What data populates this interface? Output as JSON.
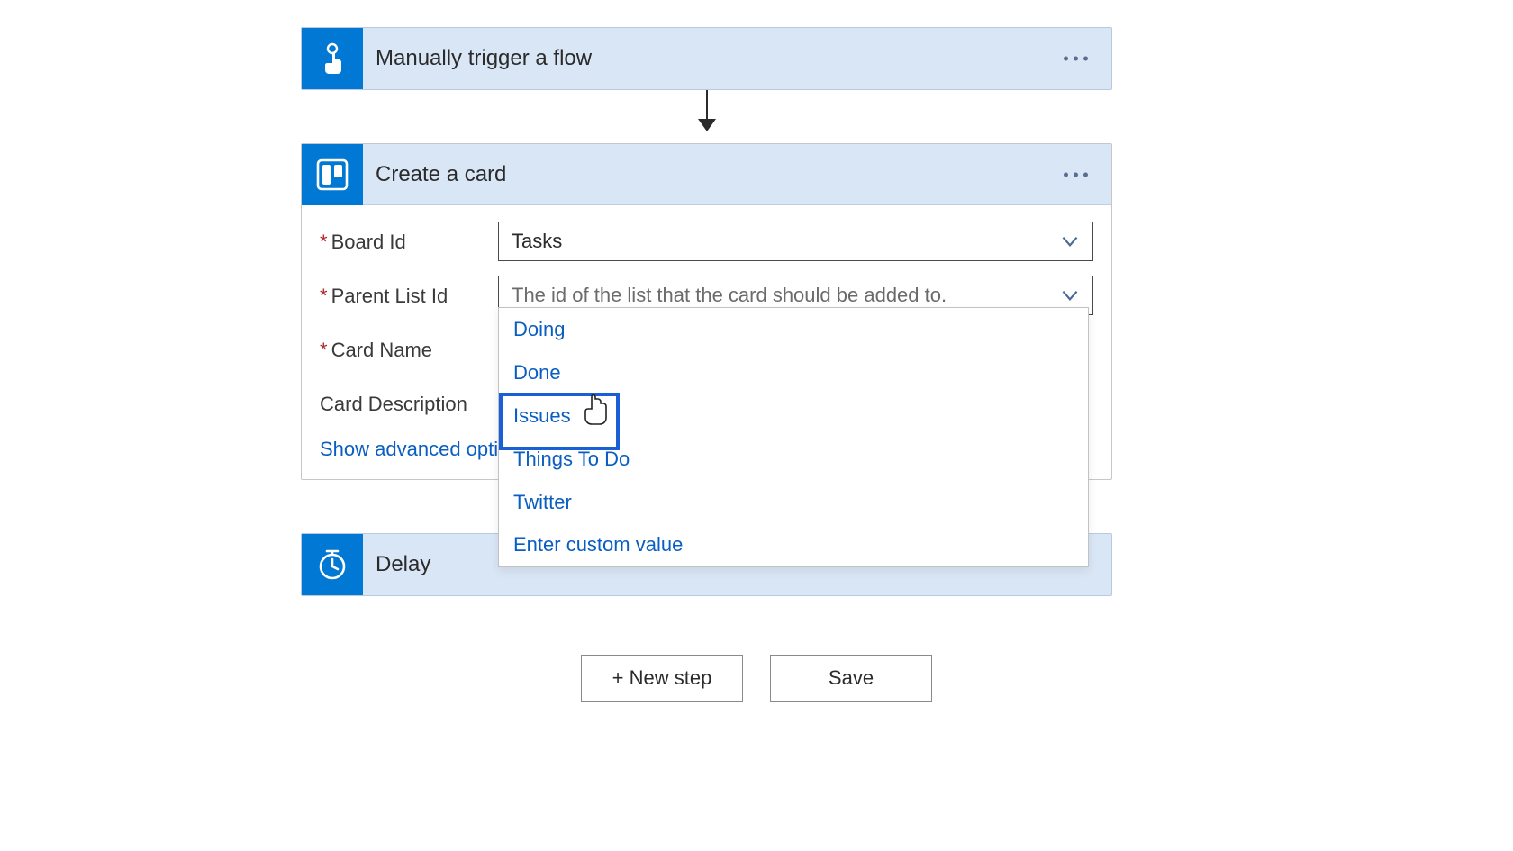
{
  "trigger": {
    "title": "Manually trigger a flow"
  },
  "createCard": {
    "title": "Create a card",
    "fields": {
      "boardId": {
        "label": "Board Id",
        "value": "Tasks"
      },
      "parentListId": {
        "label": "Parent List Id",
        "placeholder": "The id of the list that the card should be added to."
      },
      "cardName": {
        "label": "Card Name"
      },
      "cardDescription": {
        "label": "Card Description"
      }
    },
    "advancedLink": "Show advanced options"
  },
  "dropdown": {
    "items": [
      "Doing",
      "Done",
      "Issues",
      "Things To Do",
      "Twitter",
      "Enter custom value"
    ],
    "highlightedIndex": 2
  },
  "delay": {
    "title": "Delay"
  },
  "buttons": {
    "newStep": "+ New step",
    "save": "Save"
  }
}
